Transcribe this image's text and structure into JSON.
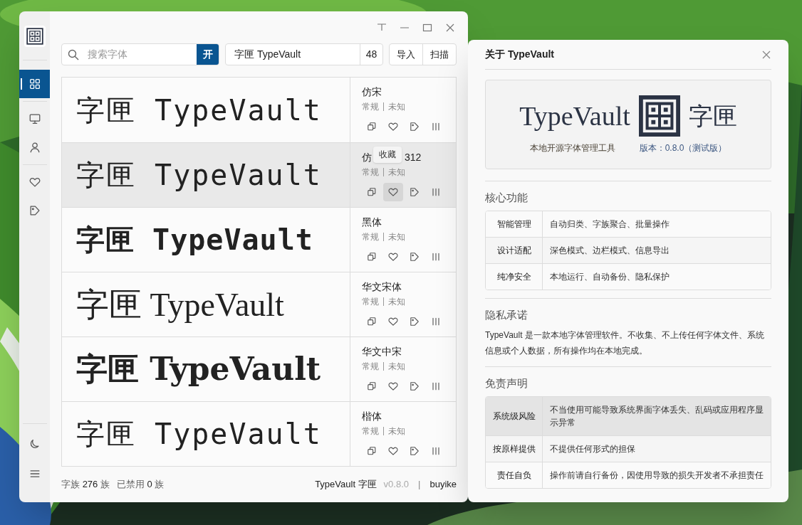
{
  "sidebar": {
    "top": [
      {
        "kind": "grid",
        "selected": true
      },
      {
        "kind": "monitor",
        "selected": false
      },
      {
        "kind": "user",
        "selected": false
      },
      {
        "kind": "heart",
        "selected": false
      },
      {
        "kind": "tag",
        "selected": false
      }
    ],
    "bottom": [
      {
        "kind": "moon",
        "selected": false
      },
      {
        "kind": "menu",
        "selected": false
      }
    ]
  },
  "toolbar": {
    "search": {
      "placeholder": "搜索字体"
    },
    "toggle": {
      "label": "开",
      "on": true
    },
    "preview": {
      "value": "字匣 TypeVault"
    },
    "size": "48",
    "buttons": [
      "导入",
      "扫描"
    ]
  },
  "fonts": [
    {
      "preview": "字匣 TypeVault",
      "kind": "mono",
      "name": "仿宋",
      "style": "常规",
      "type": "未知",
      "hovered": false,
      "favorite_hovered": false
    },
    {
      "preview": "字匣 TypeVault",
      "kind": "mono",
      "name": "仿",
      "name_tail": "312",
      "style": "常规",
      "type": "未知",
      "hovered": true,
      "favorite_hovered": true,
      "tooltip": "收藏"
    },
    {
      "preview": "字匣 TypeVault",
      "kind": "mono-bold",
      "name": "黑体",
      "style": "常规",
      "type": "未知",
      "hovered": false,
      "favorite_hovered": false
    },
    {
      "preview": "字匣 TypeVault",
      "kind": "serif",
      "name": "华文宋体",
      "style": "常规",
      "type": "未知",
      "hovered": false,
      "favorite_hovered": false
    },
    {
      "preview": "字匣 TypeVault",
      "kind": "serif-bold",
      "name": "华文中宋",
      "style": "常规",
      "type": "未知",
      "hovered": false,
      "favorite_hovered": false
    },
    {
      "preview": "字匣 TypeVault",
      "kind": "mono",
      "name": "楷体",
      "style": "常规",
      "type": "未知",
      "hovered": false,
      "favorite_hovered": false
    }
  ],
  "status_bar": {
    "families": "字族 **276** 族",
    "disabled": "已禁用 **0** 族",
    "app_name": "TypeVault 字匣",
    "version": "v0.8.0",
    "separator": "|",
    "author": "buyike"
  },
  "about": {
    "title": "关于 TypeVault",
    "hero": {
      "wordmark": "TypeVault",
      "cjk": "字匣",
      "tagline": "本地开源字体管理工具",
      "version": "版本：0.8.0（测试版）"
    },
    "sections": [
      {
        "heading": "核心功能",
        "kind": "table",
        "rows": [
          {
            "label": "智能管理",
            "text": "自动归类、字族聚合、批量操作",
            "hovered": false
          },
          {
            "label": "设计适配",
            "text": "深色模式、边栏模式、信息导出",
            "hovered": false
          },
          {
            "label": "纯净安全",
            "text": "本地运行、自动备份、隐私保护",
            "hovered": false
          }
        ]
      },
      {
        "heading": "隐私承诺",
        "kind": "paragraph",
        "text": "TypeVault 是一款本地字体管理软件。不收集、不上传任何字体文件、系统信息或个人数据，所有操作均在本地完成。"
      },
      {
        "heading": "免责声明",
        "kind": "table",
        "rows": [
          {
            "label": "系统级风险",
            "text": "不当使用可能导致系统界面字体丢失、乱码或应用程序显示异常",
            "hovered": true
          },
          {
            "label": "按原样提供",
            "text": "不提供任何形式的担保",
            "hovered": false
          },
          {
            "label": "责任自负",
            "text": "操作前请自行备份，因使用导致的损失开发者不承担责任",
            "hovered": false
          }
        ]
      }
    ]
  }
}
